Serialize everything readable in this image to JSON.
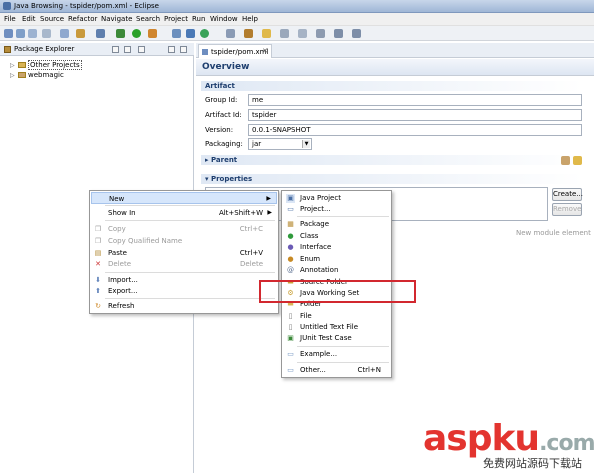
{
  "window": {
    "title": "Java Browsing - tspider/pom.xml - Eclipse"
  },
  "menubar": [
    "File",
    "Edit",
    "Source",
    "Refactor",
    "Navigate",
    "Search",
    "Project",
    "Run",
    "Window",
    "Help"
  ],
  "package_explorer": {
    "title": "Package Explorer",
    "items": [
      "Other Projects",
      "webmagic"
    ]
  },
  "editor": {
    "tab": "tspider/pom.xml",
    "overview": "Overview",
    "artifact_section": "Artifact",
    "fields": {
      "group_id_label": "Group Id:",
      "group_id_value": "me",
      "artifact_id_label": "Artifact Id:",
      "artifact_id_value": "tspider",
      "version_label": "Version:",
      "version_value": "0.0.1-SNAPSHOT",
      "packaging_label": "Packaging:",
      "packaging_value": "jar"
    },
    "parent_section": "Parent",
    "properties_section": "Properties",
    "create_button": "Create...",
    "remove_button": "Remove",
    "new_module_hint": "New module element"
  },
  "context_menu": {
    "new": "New",
    "show_in": "Show In",
    "show_in_shortcut": "Alt+Shift+W",
    "copy": "Copy",
    "copy_shortcut": "Ctrl+C",
    "copy_qualified": "Copy Qualified Name",
    "paste": "Paste",
    "paste_shortcut": "Ctrl+V",
    "delete": "Delete",
    "delete_shortcut": "Delete",
    "import": "Import...",
    "export": "Export...",
    "refresh": "Refresh"
  },
  "submenu": {
    "items": [
      "Java Project",
      "Project...",
      "Package",
      "Class",
      "Interface",
      "Enum",
      "Annotation",
      "Source Folder",
      "Java Working Set",
      "Folder",
      "File",
      "Untitled Text File",
      "JUnit Test Case",
      "Example...",
      "Other..."
    ],
    "other_shortcut": "Ctrl+N"
  },
  "watermark": {
    "brand": "aspku",
    "domain": ".com",
    "tagline": "免费网站源码下载站"
  }
}
